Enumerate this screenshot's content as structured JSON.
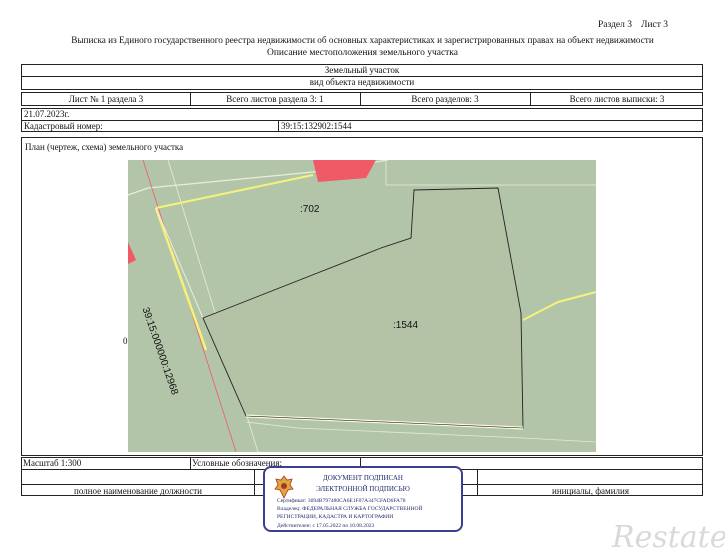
{
  "header": {
    "section": "Раздел 3",
    "sheet": "Лист 3",
    "title": "Выписка из Единого государственного реестра недвижимости об основных характеристиках и зарегистрированных правах на объект недвижимости",
    "subtitle": "Описание местоположения земельного участка"
  },
  "object": {
    "type": "Земельный участок",
    "kind_label": "вид объекта недвижимости"
  },
  "sheets_row": {
    "sheet_of_section": "Лист № 1 раздела 3",
    "total_section_sheets": "Всего листов раздела 3: 1",
    "total_sections": "Всего разделов: 3",
    "total_extract_sheets": "Всего листов выписки: 3"
  },
  "date": "21.07.2023г.",
  "cadastral": {
    "label": "Кадастровый номер:",
    "value": "39:15:132902:1544"
  },
  "plan": {
    "title": "План (чертеж, схема) земельного участка",
    "parcel_main": ":1544",
    "parcel_neighbor": ":702",
    "road": "39:15:000000:12968",
    "edge_mark": "0"
  },
  "footer": {
    "scale": "Масштаб 1:300",
    "legend": "Условные обозначения:",
    "position_label": "полное наименование должности",
    "initials_label": "инициалы, фамилия"
  },
  "signature": {
    "line1": "ДОКУМЕНТ ПОДПИСАН",
    "line2": "ЭЛЕКТРОННОЙ ПОДПИСЬЮ",
    "cert": "Сертификат: 3094B797480CA6E1F07A347CFAD6FA78",
    "owner1": "Владелец: ФЕДЕРАЛЬНАЯ СЛУЖБА ГОСУДАРСТВЕННОЙ",
    "owner2": "РЕГИСТРАЦИИ, КАДАСТРА И КАРТОГРАФИИ",
    "valid": "Действителен: с 17.05.2022 по 10.08.2023"
  },
  "watermark": "Restate",
  "colors": {
    "map_bg": "#b3c5a9",
    "parcel_fill": "#b4c2a6",
    "red_zone": "#f05a67",
    "highlight": "#f4f27a",
    "stamp_border": "#3b3f8f"
  }
}
